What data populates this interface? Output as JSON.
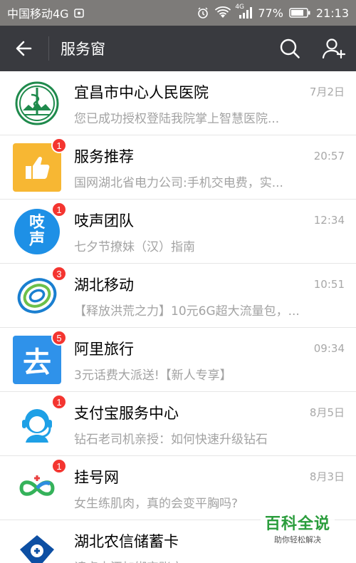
{
  "statusbar": {
    "carrier": "中国移动4G",
    "network": "4G",
    "battery": "77%",
    "time": "21:13"
  },
  "nav": {
    "title": "服务窗"
  },
  "items": [
    {
      "name": "宜昌市中心人民医院",
      "time": "7月2日",
      "preview": "您已成功授权登陆我院掌上智慧医院...",
      "badge": ""
    },
    {
      "name": "服务推荐",
      "time": "20:57",
      "preview": "国网湖北省电力公司:手机交电费，实...",
      "badge": "1"
    },
    {
      "name": "吱声团队",
      "time": "12:34",
      "preview": "七夕节撩妹（汉）指南",
      "badge": "1"
    },
    {
      "name": "湖北移动",
      "time": "10:51",
      "preview": "【释放洪荒之力】10元6G超大流量包，...",
      "badge": "3"
    },
    {
      "name": "阿里旅行",
      "time": "09:34",
      "preview": "3元话费大派送!【新人专享】",
      "badge": "5"
    },
    {
      "name": "支付宝服务中心",
      "time": "8月5日",
      "preview": "钻石老司机亲授：如何快速升级钻石",
      "badge": "1"
    },
    {
      "name": "挂号网",
      "time": "8月3日",
      "preview": "女生练肌肉，真的会变平胸吗?",
      "badge": "1"
    },
    {
      "name": "湖北农信储蓄卡",
      "time": "",
      "preview": "请点击添加绑定账户",
      "badge": ""
    }
  ],
  "avatar_text": {
    "zhisheng_line1": "吱",
    "zhisheng_line2": "声",
    "alitrip": "去"
  },
  "watermark": {
    "title": "百科全说",
    "subtitle": "助你轻松解决"
  }
}
